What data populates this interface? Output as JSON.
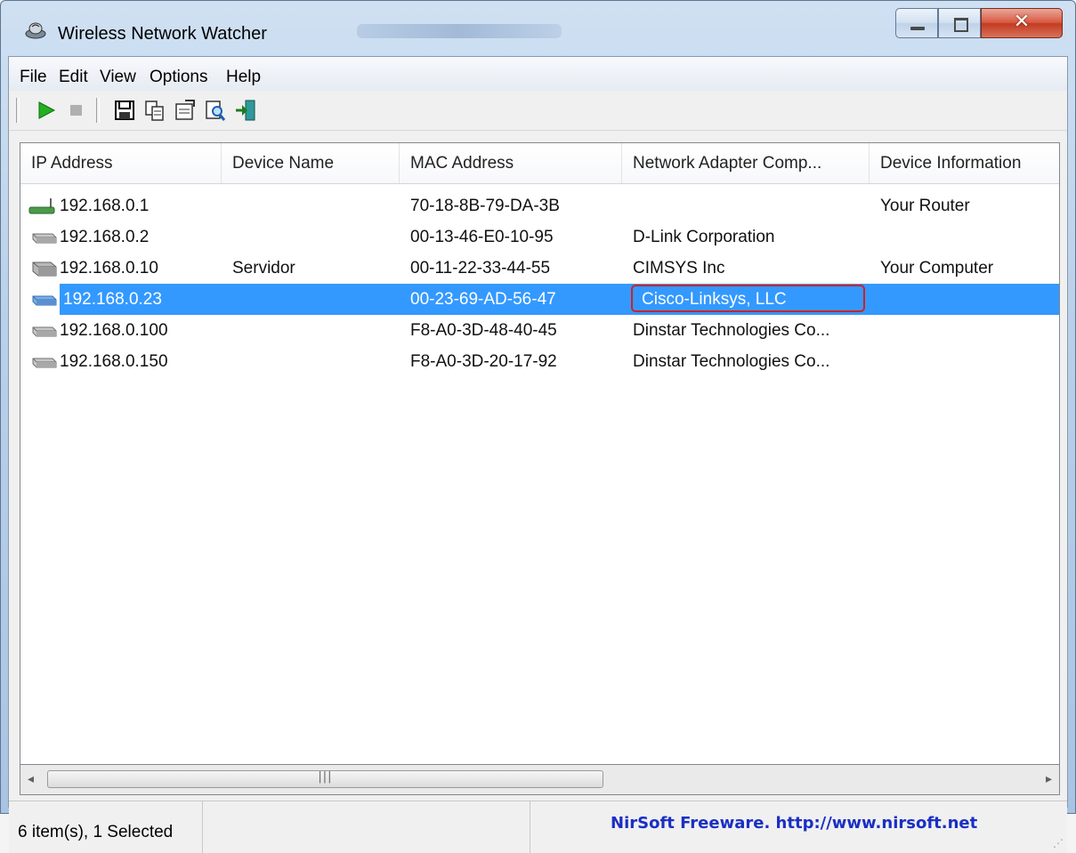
{
  "window": {
    "title": "Wireless Network Watcher"
  },
  "menu": [
    {
      "label": "File"
    },
    {
      "label": "Edit"
    },
    {
      "label": "View"
    },
    {
      "label": "Options"
    },
    {
      "label": "Help"
    }
  ],
  "toolbar": {
    "start_icon": "play-icon",
    "stop_icon": "stop-icon",
    "save_icon": "save-icon",
    "copy_icon": "copy-icon",
    "properties_icon": "properties-icon",
    "find_icon": "find-icon",
    "exit_icon": "exit-icon"
  },
  "columns": [
    {
      "label": "IP Address"
    },
    {
      "label": "Device Name"
    },
    {
      "label": "MAC Address"
    },
    {
      "label": "Network Adapter Comp..."
    },
    {
      "label": "Device Information"
    }
  ],
  "rows": [
    {
      "ip": "192.168.0.1",
      "name": "",
      "mac": "70-18-8B-79-DA-3B",
      "company": "",
      "info": "Your Router",
      "icon": "router-icon",
      "selected": false
    },
    {
      "ip": "192.168.0.2",
      "name": "",
      "mac": "00-13-46-E0-10-95",
      "company": "D-Link Corporation",
      "info": "",
      "icon": "network-device-icon",
      "selected": false
    },
    {
      "ip": "192.168.0.10",
      "name": "Servidor",
      "mac": "00-11-22-33-44-55",
      "company": "CIMSYS Inc",
      "info": "Your Computer",
      "icon": "computer-icon",
      "selected": false
    },
    {
      "ip": "192.168.0.23",
      "name": "",
      "mac": "00-23-69-AD-56-47",
      "company": "Cisco-Linksys, LLC",
      "info": "",
      "icon": "network-device-icon",
      "selected": true
    },
    {
      "ip": "192.168.0.100",
      "name": "",
      "mac": "F8-A0-3D-48-40-45",
      "company": "Dinstar Technologies Co...",
      "info": "",
      "icon": "network-device-icon",
      "selected": false
    },
    {
      "ip": "192.168.0.150",
      "name": "",
      "mac": "F8-A0-3D-20-17-92",
      "company": "Dinstar Technologies Co...",
      "info": "",
      "icon": "network-device-icon",
      "selected": false
    }
  ],
  "status": {
    "count": "6 item(s), 1 Selected",
    "link": "NirSoft Freeware.  http://www.nirsoft.net"
  },
  "colors": {
    "selection": "#3399ff",
    "highlight_border": "#d42020",
    "link": "#1a2fc4"
  }
}
